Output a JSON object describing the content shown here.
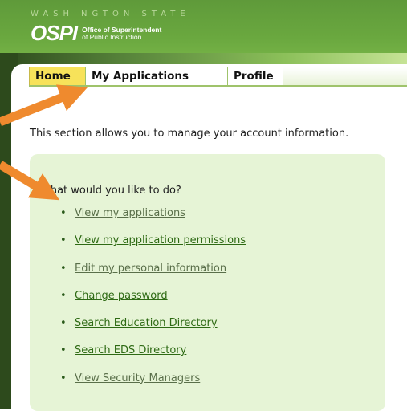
{
  "header": {
    "state_text": "WASHINGTON STATE",
    "logo_word": "OSPI",
    "logo_line1": "Office of Superintendent",
    "logo_line2": "of Public Instruction"
  },
  "tabs": [
    {
      "label": "Home",
      "active": true
    },
    {
      "label": "My Applications",
      "active": false
    },
    {
      "label": "Profile",
      "active": false
    }
  ],
  "main": {
    "description": "This section allows you to manage your account information.",
    "question": "What would you like to do?",
    "links": [
      {
        "label": "View my applications",
        "visited": true
      },
      {
        "label": "View my application permissions",
        "visited": false
      },
      {
        "label": "Edit my personal information",
        "visited": true
      },
      {
        "label": "Change password",
        "visited": false
      },
      {
        "label": "Search Education Directory",
        "visited": false
      },
      {
        "label": "Search EDS Directory",
        "visited": false
      },
      {
        "label": "View Security Managers",
        "visited": true
      }
    ]
  },
  "colors": {
    "arrow": "#ef8a2e",
    "active_tab": "#f7e25a",
    "panel": "#e6f4d6",
    "link": "#2e6a14"
  }
}
